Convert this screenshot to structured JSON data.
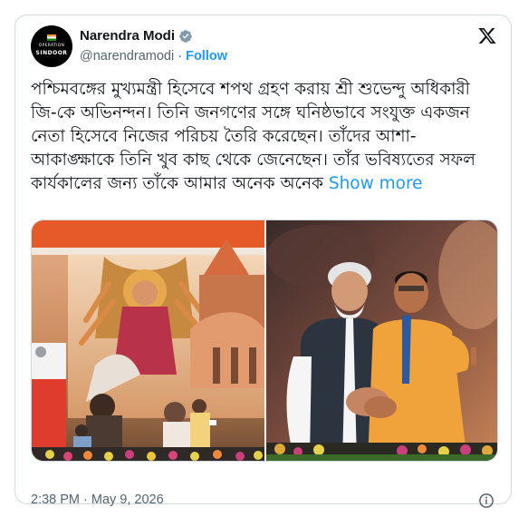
{
  "author": {
    "name": "Narendra Modi",
    "handle": "@narendramodi",
    "separator": " · ",
    "follow_label": "Follow",
    "avatar_line1": "OPERATION",
    "avatar_line2": "SINDOOR",
    "verified_icon": "verified-badge-icon",
    "colors": {
      "follow": "#1d9bf0",
      "verified": "#829aab"
    }
  },
  "tweet": {
    "text": "পশ্চিমবঙ্গের মুখ্যমন্ত্রী হিসেবে শপথ গ্রহণ করায় শ্রী শুভেন্দু অধিকারী জি-কে অভিনন্দন। তিনি জনগণের সঙ্গে ঘনিষ্ঠভাবে সংযুক্ত একজন নেতা হিসেবে নিজের পরিচয় তৈরি করেছেন। তাঁদের আশা-আকাঙ্ক্ষাকে তিনি খুব কাছ থেকে জেনেছেন। তাঁর ভবিষ্যতের সফল কার্যকালের জন্য তাঁকে আমার অনেক অনেক",
    "show_more_label": "Show more",
    "timestamp": "2:38 PM · May 9, 2026"
  },
  "media": {
    "photos": [
      {
        "name": "photo-ceremony-stage"
      },
      {
        "name": "photo-leaders-embrace"
      }
    ]
  },
  "icons": {
    "platform": "x-logo-icon",
    "info": "info-icon"
  }
}
